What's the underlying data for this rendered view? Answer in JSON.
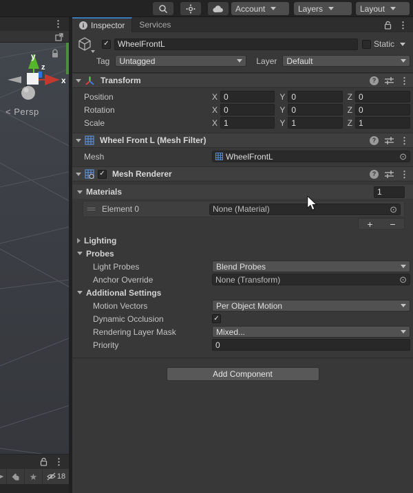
{
  "toolbar": {
    "account_label": "Account",
    "layers_label": "Layers",
    "layout_label": "Layout"
  },
  "tab_bar": {
    "inspector_tab": "Inspector",
    "services_tab": "Services"
  },
  "header": {
    "name": "WheelFrontL",
    "static_label": "Static",
    "tag_label": "Tag",
    "tag_value": "Untagged",
    "layer_label": "Layer",
    "layer_value": "Default"
  },
  "transform": {
    "title": "Transform",
    "axis_x": "X",
    "axis_y": "Y",
    "axis_z": "Z",
    "rows": [
      {
        "label": "Position",
        "x": "0",
        "y": "0",
        "z": "0"
      },
      {
        "label": "Rotation",
        "x": "0",
        "y": "0",
        "z": "0"
      },
      {
        "label": "Scale",
        "x": "1",
        "y": "1",
        "z": "1"
      }
    ]
  },
  "mesh_filter": {
    "title": "Wheel Front L (Mesh Filter)",
    "mesh_label": "Mesh",
    "mesh_value": "WheelFrontL"
  },
  "mesh_renderer": {
    "title": "Mesh Renderer",
    "materials": {
      "label": "Materials",
      "count": "1",
      "element_label": "Element 0",
      "element_value": "None (Material)",
      "add_label": "+",
      "remove_label": "−"
    },
    "lighting_label": "Lighting",
    "probes": {
      "label": "Probes",
      "light_probes_label": "Light Probes",
      "light_probes_value": "Blend Probes",
      "anchor_label": "Anchor Override",
      "anchor_value": "None (Transform)"
    },
    "additional": {
      "label": "Additional Settings",
      "motion_label": "Motion Vectors",
      "motion_value": "Per Object Motion",
      "occlusion_label": "Dynamic Occlusion",
      "mask_label": "Rendering Layer Mask",
      "mask_value": "Mixed...",
      "priority_label": "Priority",
      "priority_value": "0"
    }
  },
  "add_component_label": "Add Component",
  "scene_view": {
    "persp_chevron": "<",
    "persp_label": "Persp",
    "axis_x": "x",
    "axis_y": "y",
    "axis_z": "z"
  },
  "bottom_bar": {
    "hidden_count": "18"
  },
  "colors": {
    "tab_accent": "#3a79bb",
    "panel_bg": "#383838",
    "field_bg": "#282828",
    "dropdown_bg": "#515151",
    "toolbar_bg": "#232323"
  }
}
